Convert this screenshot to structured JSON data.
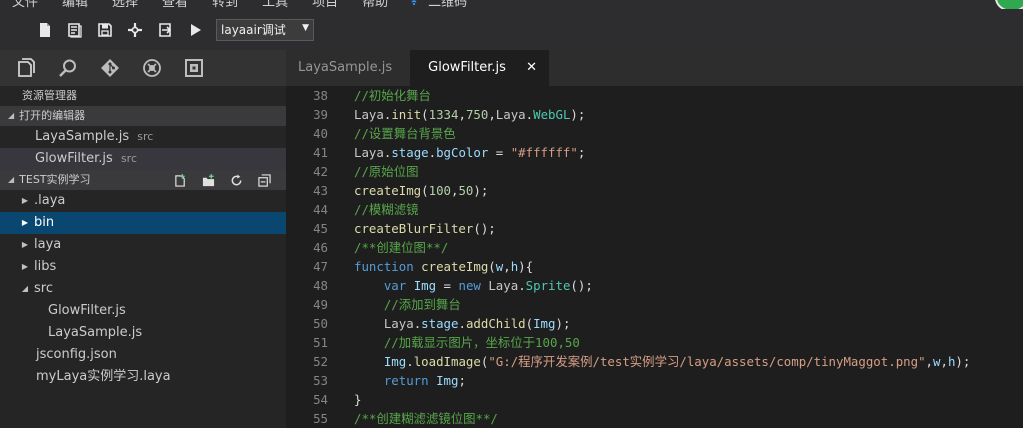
{
  "menu": [
    "文件",
    "编辑",
    "选择",
    "查看",
    "转到",
    "工具",
    "项目",
    "帮助",
    "二维码"
  ],
  "toolbar": {
    "config_select": "layaair调试",
    "icons": [
      "new-file-icon",
      "open-file-icon",
      "save-icon",
      "compile-icon",
      "export-icon",
      "run-icon"
    ]
  },
  "activity": [
    "explorer-icon",
    "search-icon",
    "git-icon",
    "debug-icon",
    "extensions-icon"
  ],
  "sidebar": {
    "title": "资源管理器",
    "open_editors": {
      "label": "打开的编辑器",
      "items": [
        {
          "name": "LayaSample.js",
          "path": "src"
        },
        {
          "name": "GlowFilter.js",
          "path": "src"
        }
      ]
    },
    "project": {
      "label": "TEST实例学习",
      "tree": [
        {
          "name": ".laya",
          "twisty": "▶"
        },
        {
          "name": "bin",
          "twisty": "▶"
        },
        {
          "name": "laya",
          "twisty": "▶"
        },
        {
          "name": "libs",
          "twisty": "▶"
        },
        {
          "name": "src",
          "twisty": "◢"
        },
        {
          "name": "GlowFilter.js",
          "twisty": ""
        },
        {
          "name": "LayaSample.js",
          "twisty": ""
        },
        {
          "name": "jsconfig.json",
          "twisty": ""
        },
        {
          "name": "myLaya实例学习.laya",
          "twisty": ""
        }
      ]
    }
  },
  "tabs": [
    {
      "label": "LayaSample.js"
    },
    {
      "label": "GlowFilter.js",
      "close": "✕"
    }
  ],
  "editor": {
    "lines": [
      {
        "n": "38",
        "tokens": [
          {
            "t": "//初始化舞台",
            "c": "cm"
          }
        ]
      },
      {
        "n": "39",
        "tokens": [
          {
            "t": "Laya",
            "c": "vb"
          },
          {
            "t": ".",
            "c": "op"
          },
          {
            "t": "init",
            "c": "fn"
          },
          {
            "t": "(",
            "c": "op"
          },
          {
            "t": "1334",
            "c": "nm"
          },
          {
            "t": ",",
            "c": "op"
          },
          {
            "t": "750",
            "c": "nm"
          },
          {
            "t": ",",
            "c": "op"
          },
          {
            "t": "Laya",
            "c": "vb"
          },
          {
            "t": ".",
            "c": "op"
          },
          {
            "t": "WebGL",
            "c": "cl"
          },
          {
            "t": ");",
            "c": "op"
          }
        ]
      },
      {
        "n": "40",
        "tokens": [
          {
            "t": "//设置舞台背景色",
            "c": "cm"
          }
        ]
      },
      {
        "n": "41",
        "tokens": [
          {
            "t": "Laya",
            "c": "vb"
          },
          {
            "t": ".",
            "c": "op"
          },
          {
            "t": "stage",
            "c": "vr"
          },
          {
            "t": ".",
            "c": "op"
          },
          {
            "t": "bgColor",
            "c": "vr"
          },
          {
            "t": " = ",
            "c": "op"
          },
          {
            "t": "\"#ffffff\"",
            "c": "st"
          },
          {
            "t": ";",
            "c": "op"
          }
        ]
      },
      {
        "n": "42",
        "tokens": [
          {
            "t": "//原始位图",
            "c": "cm"
          }
        ]
      },
      {
        "n": "43",
        "tokens": [
          {
            "t": "createImg",
            "c": "fn"
          },
          {
            "t": "(",
            "c": "op"
          },
          {
            "t": "100",
            "c": "nm"
          },
          {
            "t": ",",
            "c": "op"
          },
          {
            "t": "50",
            "c": "nm"
          },
          {
            "t": ");",
            "c": "op"
          }
        ]
      },
      {
        "n": "44",
        "tokens": [
          {
            "t": "//模糊滤镜",
            "c": "cm"
          }
        ]
      },
      {
        "n": "45",
        "tokens": [
          {
            "t": "createBlurFilter",
            "c": "fn"
          },
          {
            "t": "();",
            "c": "op"
          }
        ]
      },
      {
        "n": "46",
        "tokens": [
          {
            "t": "/**创建位图**/",
            "c": "cm"
          }
        ]
      },
      {
        "n": "47",
        "tokens": [
          {
            "t": "function",
            "c": "kw"
          },
          {
            "t": " ",
            "c": "op"
          },
          {
            "t": "createImg",
            "c": "fn"
          },
          {
            "t": "(",
            "c": "op"
          },
          {
            "t": "w",
            "c": "vr"
          },
          {
            "t": ",",
            "c": "op"
          },
          {
            "t": "h",
            "c": "vr"
          },
          {
            "t": "){",
            "c": "op"
          }
        ]
      },
      {
        "n": "48",
        "tokens": [
          {
            "t": "    ",
            "c": "op"
          },
          {
            "t": "var",
            "c": "kw"
          },
          {
            "t": " ",
            "c": "op"
          },
          {
            "t": "Img",
            "c": "vr"
          },
          {
            "t": " = ",
            "c": "op"
          },
          {
            "t": "new",
            "c": "kw"
          },
          {
            "t": " ",
            "c": "op"
          },
          {
            "t": "Laya",
            "c": "vb"
          },
          {
            "t": ".",
            "c": "op"
          },
          {
            "t": "Sprite",
            "c": "cl"
          },
          {
            "t": "();",
            "c": "op"
          }
        ]
      },
      {
        "n": "49",
        "tokens": [
          {
            "t": "    ",
            "c": "op"
          },
          {
            "t": "//添加到舞台",
            "c": "cm"
          }
        ]
      },
      {
        "n": "50",
        "tokens": [
          {
            "t": "    ",
            "c": "op"
          },
          {
            "t": "Laya",
            "c": "vb"
          },
          {
            "t": ".",
            "c": "op"
          },
          {
            "t": "stage",
            "c": "vr"
          },
          {
            "t": ".",
            "c": "op"
          },
          {
            "t": "addChild",
            "c": "fn"
          },
          {
            "t": "(",
            "c": "op"
          },
          {
            "t": "Img",
            "c": "vr"
          },
          {
            "t": ");",
            "c": "op"
          }
        ]
      },
      {
        "n": "51",
        "tokens": [
          {
            "t": "    ",
            "c": "op"
          },
          {
            "t": "//加载显示图片，坐标位于100,50",
            "c": "cm"
          }
        ]
      },
      {
        "n": "52",
        "tokens": [
          {
            "t": "    ",
            "c": "op"
          },
          {
            "t": "Img",
            "c": "vr"
          },
          {
            "t": ".",
            "c": "op"
          },
          {
            "t": "loadImage",
            "c": "fn"
          },
          {
            "t": "(",
            "c": "op"
          },
          {
            "t": "\"G:/程序开发案例/test实例学习/laya/assets/comp/tinyMaggot.png\"",
            "c": "st"
          },
          {
            "t": ",",
            "c": "op"
          },
          {
            "t": "w",
            "c": "vr"
          },
          {
            "t": ",",
            "c": "op"
          },
          {
            "t": "h",
            "c": "vr"
          },
          {
            "t": ");",
            "c": "op"
          }
        ]
      },
      {
        "n": "53",
        "tokens": [
          {
            "t": "    ",
            "c": "op"
          },
          {
            "t": "return",
            "c": "kw"
          },
          {
            "t": " ",
            "c": "op"
          },
          {
            "t": "Img",
            "c": "vr"
          },
          {
            "t": ";",
            "c": "op"
          }
        ]
      },
      {
        "n": "54",
        "tokens": [
          {
            "t": "}",
            "c": "op"
          }
        ]
      },
      {
        "n": "55",
        "tokens": [
          {
            "t": "/**创建糊滤滤镜位图**/",
            "c": "cm"
          }
        ]
      }
    ]
  }
}
